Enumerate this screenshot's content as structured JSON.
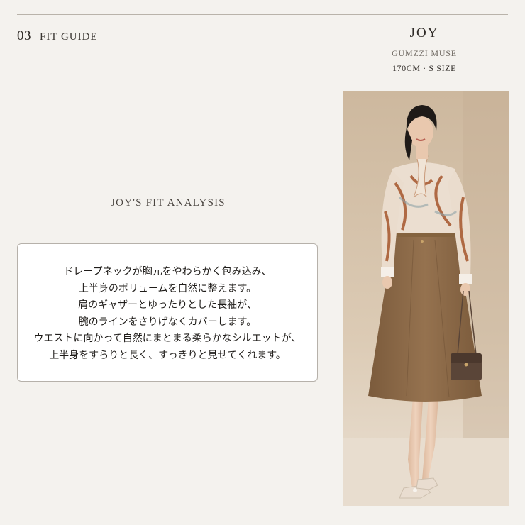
{
  "header": {
    "section_number": "03",
    "section_title": "FIT GUIDE"
  },
  "model": {
    "name": "JOY",
    "brand": "GUMZZI MUSE",
    "size": "170CM · S SIZE"
  },
  "analysis": {
    "title": "JOY'S FIT ANALYSIS",
    "lines": [
      "ドレープネックが胸元をやわらかく包み込み、",
      "上半身のボリュームを自然に整えます。",
      "肩のギャザーとゆったりとした長袖が、",
      "腕のラインをさりげなくカバーします。",
      "ウエストに向かって自然にまとまる柔らかなシルエットが、",
      "上半身をすらりと長く、すっきりと見せてくれます。"
    ]
  },
  "photo": {
    "subject": "model-photo",
    "colors": {
      "background": "#d8c7b0",
      "floor": "#e7dccd",
      "skirt": "#8b6a48",
      "blouse": "#e9dccd",
      "blouse_pattern": "#a5552c",
      "hair": "#1f1a17",
      "skin": "#e9c8ae",
      "bag": "#5a4538"
    }
  }
}
